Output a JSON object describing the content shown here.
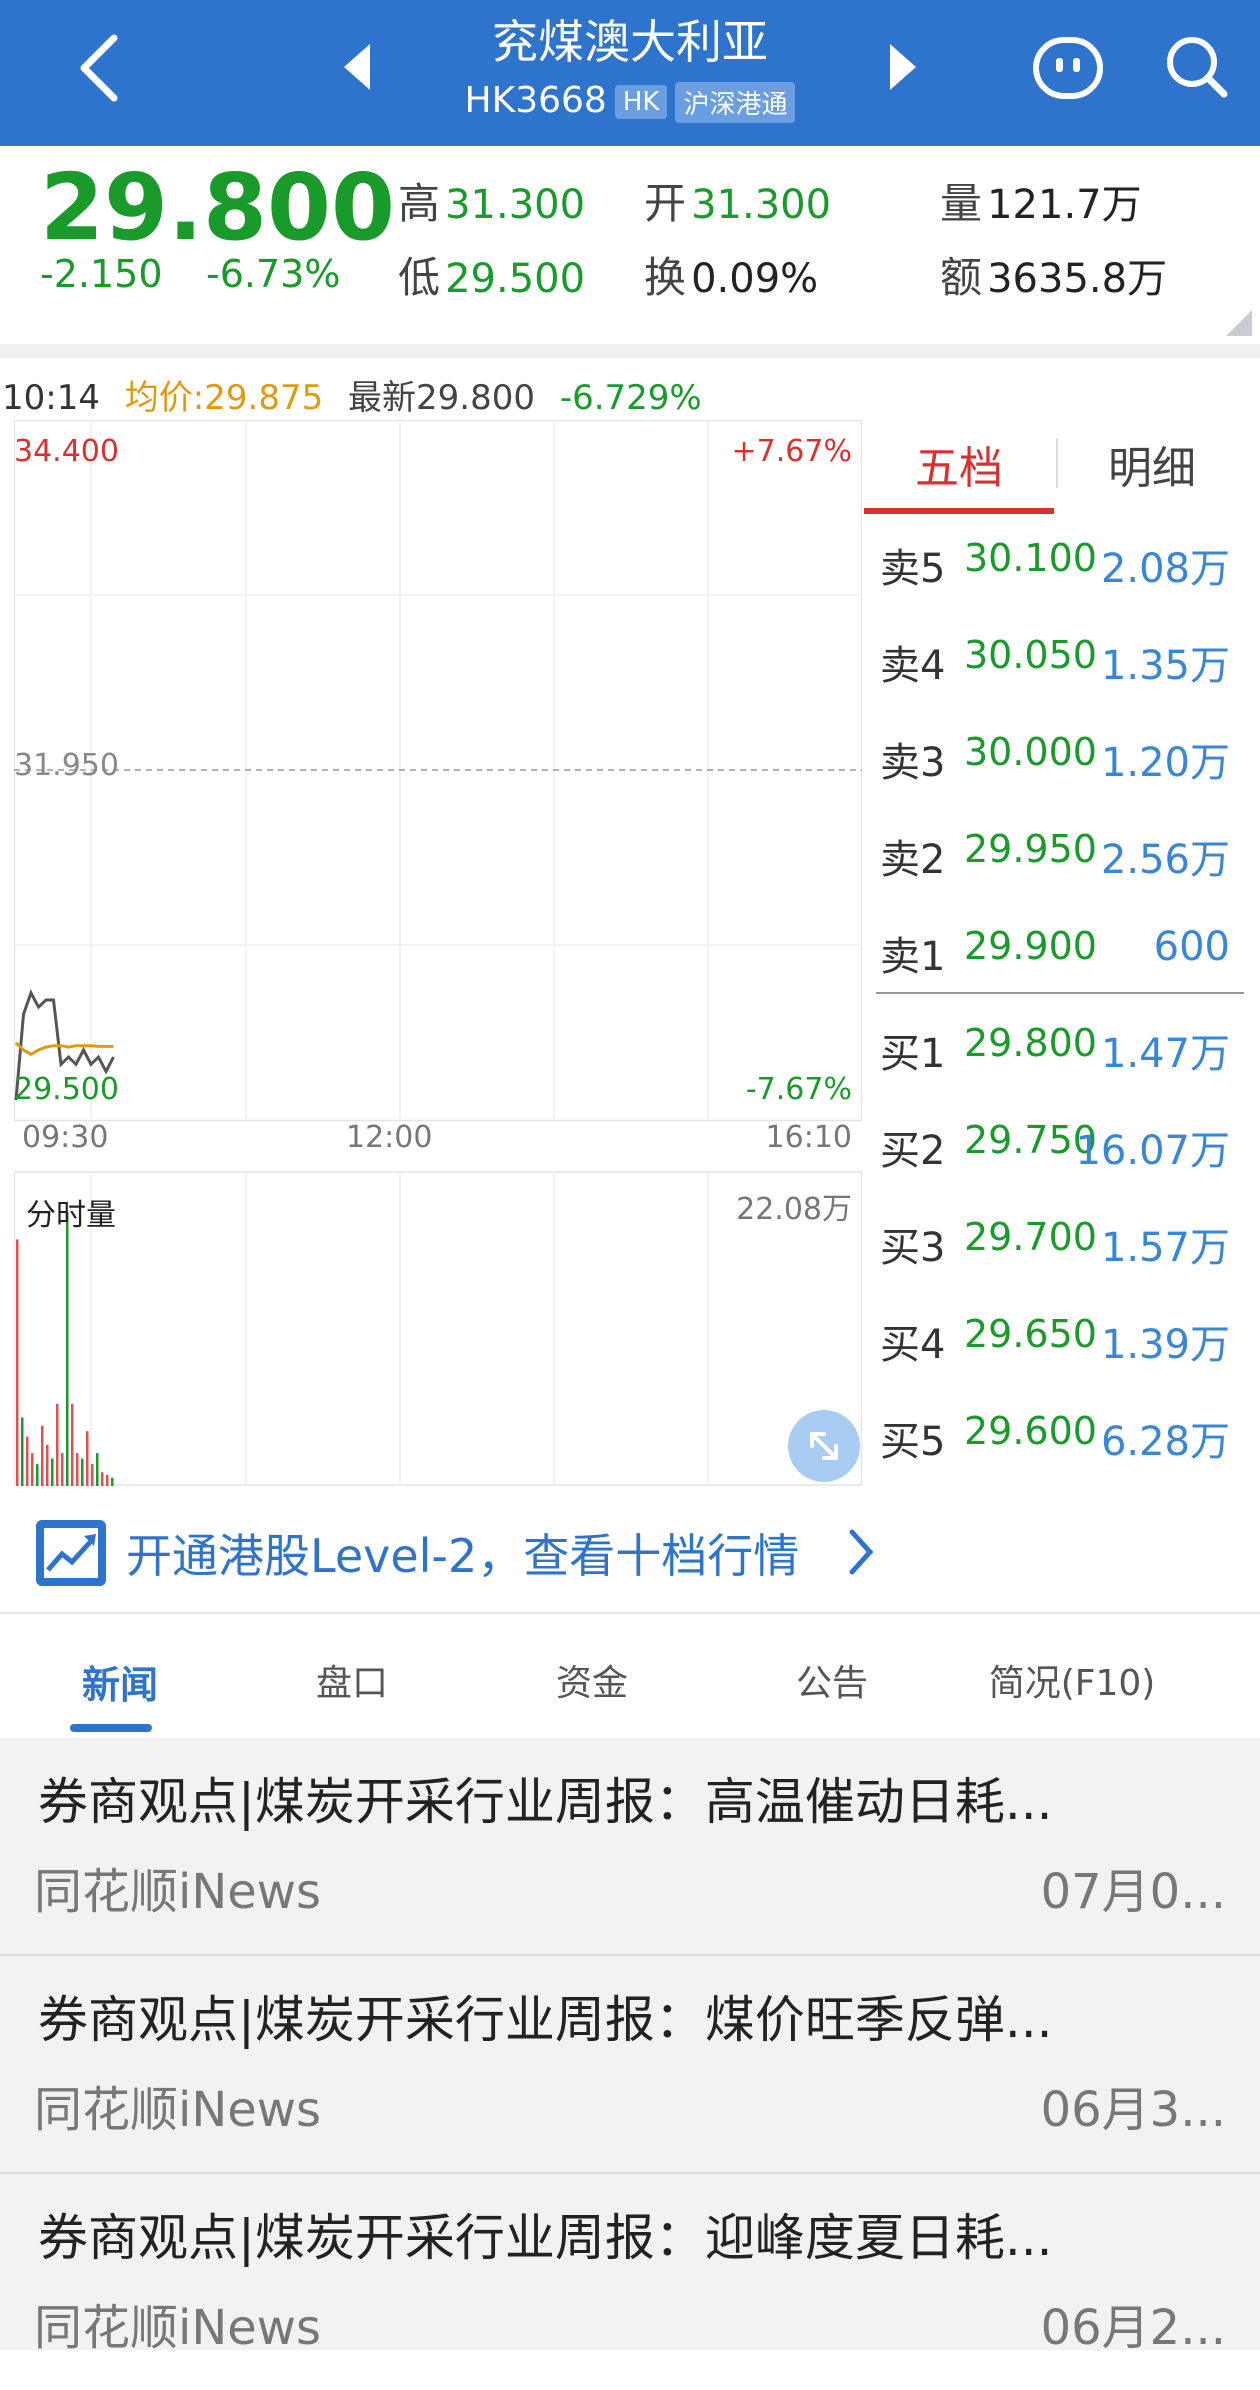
{
  "header": {
    "title": "兖煤澳大利亚",
    "code": "HK3668",
    "tag_market": "HK",
    "tag_connect": "沪深港通"
  },
  "quote": {
    "price": "29.800",
    "change": "-2.150",
    "change_pct": "-6.73%",
    "high_label": "高",
    "high": "31.300",
    "open_label": "开",
    "open": "31.300",
    "volume_label": "量",
    "volume": "121.7万",
    "low_label": "低",
    "low": "29.500",
    "turnover_label": "换",
    "turnover": "0.09%",
    "amount_label": "额",
    "amount": "3635.8万"
  },
  "info": {
    "time": "10:14",
    "avg": "均价:29.875",
    "latest": "最新29.800",
    "pct": "-6.729%"
  },
  "chart": {
    "y_max": "34.400",
    "y_mid": "31.950",
    "y_min": "29.500",
    "pct_max": "+7.67%",
    "pct_min": "-7.67%",
    "x_start": "09:30",
    "x_mid": "12:00",
    "x_end": "16:10",
    "volume_label": "分时量",
    "volume_max": "22.08万"
  },
  "chart_data": {
    "type": "line",
    "ylim": [
      29.5,
      34.4
    ],
    "x_ticks": [
      "09:30",
      "12:00",
      "16:10"
    ],
    "series": [
      {
        "values": [
          29.5,
          30.1,
          30.25,
          30.15,
          30.2,
          30.2,
          29.75,
          29.8,
          29.75,
          29.85,
          29.75,
          29.8,
          29.7,
          29.8
        ]
      },
      {
        "values": [
          29.9,
          29.85,
          29.82,
          29.85,
          29.87,
          29.88,
          29.88,
          29.87,
          29.88,
          29.88,
          29.88,
          29.875,
          29.875,
          29.875
        ]
      }
    ],
    "volume_max": "22.08万"
  },
  "depth": {
    "tab_five": "五档",
    "tab_detail": "明细",
    "asks": [
      {
        "label": "卖5",
        "price": "30.100",
        "vol": "2.08万"
      },
      {
        "label": "卖4",
        "price": "30.050",
        "vol": "1.35万"
      },
      {
        "label": "卖3",
        "price": "30.000",
        "vol": "1.20万"
      },
      {
        "label": "卖2",
        "price": "29.950",
        "vol": "2.56万"
      },
      {
        "label": "卖1",
        "price": "29.900",
        "vol": "600"
      }
    ],
    "bids": [
      {
        "label": "买1",
        "price": "29.800",
        "vol": "1.47万"
      },
      {
        "label": "买2",
        "price": "29.750",
        "vol": "16.07万"
      },
      {
        "label": "买3",
        "price": "29.700",
        "vol": "1.57万"
      },
      {
        "label": "买4",
        "price": "29.650",
        "vol": "1.39万"
      },
      {
        "label": "买5",
        "price": "29.600",
        "vol": "6.28万"
      }
    ]
  },
  "promo": {
    "text": "开通港股Level-2，查看十档行情"
  },
  "tabs": [
    "新闻",
    "盘口",
    "资金",
    "公告",
    "简况(F10)"
  ],
  "news": [
    {
      "title": "券商观点|煤炭开采行业周报：高温催动日耗...",
      "source": "同花顺iNews",
      "date": "07月0..."
    },
    {
      "title": "券商观点|煤炭开采行业周报：煤价旺季反弹...",
      "source": "同花顺iNews",
      "date": "06月3..."
    },
    {
      "title": "券商观点|煤炭开采行业周报：迎峰度夏日耗...",
      "source": "同花顺iNews",
      "date": "06月2..."
    }
  ]
}
